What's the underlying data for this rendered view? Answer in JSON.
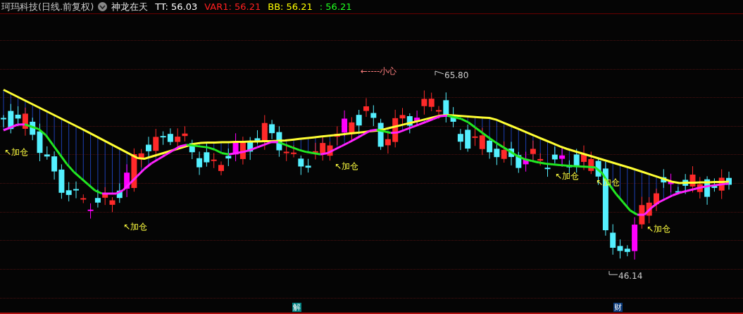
{
  "header": {
    "stock": "珂玛科技(日线.前复权)",
    "indicator": "神龙在天",
    "values": [
      {
        "text": "TT: 56.03",
        "color": "#ffffff"
      },
      {
        "text": "VAR1: 56.21",
        "color": "#ff2020"
      },
      {
        "text": "BB: 56.21",
        "color": "#ffff00"
      },
      {
        "text": ": 56.21",
        "color": "#20ff20"
      }
    ]
  },
  "chart": {
    "signals": [
      {
        "text": "↖加仓"
      },
      {
        "text": "↖加仓"
      },
      {
        "text": "↖加仓"
      },
      {
        "text": "↖加仓"
      },
      {
        "text": "↖加仓"
      },
      {
        "text": "↖加仓"
      }
    ],
    "warning": "←----小心",
    "high_label": "65.80",
    "low_label": "46.14"
  },
  "markers": [
    {
      "text": "解",
      "color": "#008080"
    },
    {
      "text": "财",
      "color": "#0a3a7a"
    }
  ]
}
